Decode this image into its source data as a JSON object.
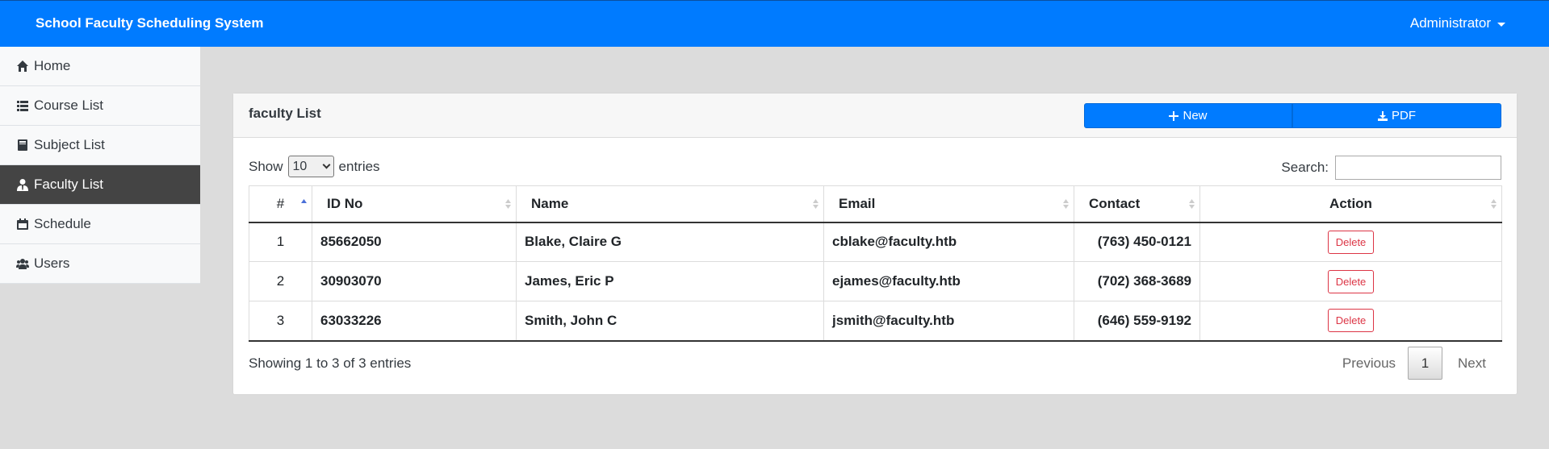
{
  "app": {
    "title": "School Faculty Scheduling System",
    "user_menu": "Administrator"
  },
  "sidebar": {
    "items": [
      {
        "label": "Home",
        "icon": "home-icon",
        "active": false
      },
      {
        "label": "Course List",
        "icon": "list-icon",
        "active": false
      },
      {
        "label": "Subject List",
        "icon": "book-icon",
        "active": false
      },
      {
        "label": "Faculty List",
        "icon": "user-tie-icon",
        "active": true
      },
      {
        "label": "Schedule",
        "icon": "calendar-icon",
        "active": false
      },
      {
        "label": "Users",
        "icon": "users-icon",
        "active": false
      }
    ]
  },
  "card": {
    "title": "faculty List",
    "new_label": "New",
    "pdf_label": "PDF"
  },
  "table_controls": {
    "show_label": "Show",
    "entries_value": "10",
    "entries_label": "entries",
    "search_label": "Search:",
    "search_value": ""
  },
  "table": {
    "headers": [
      "#",
      "ID No",
      "Name",
      "Email",
      "Contact",
      "Action"
    ],
    "rows": [
      {
        "num": "1",
        "id": "85662050",
        "name": "Blake, Claire G",
        "email": "cblake@faculty.htb",
        "contact": "(763) 450-0121",
        "action": "Delete"
      },
      {
        "num": "2",
        "id": "30903070",
        "name": "James, Eric P",
        "email": "ejames@faculty.htb",
        "contact": "(702) 368-3689",
        "action": "Delete"
      },
      {
        "num": "3",
        "id": "63033226",
        "name": "Smith, John C",
        "email": "jsmith@faculty.htb",
        "contact": "(646) 559-9192",
        "action": "Delete"
      }
    ]
  },
  "footer": {
    "info": "Showing 1 to 3 of 3 entries",
    "previous": "Previous",
    "page": "1",
    "next": "Next"
  },
  "colors": {
    "primary": "#007bff",
    "danger": "#dc3545",
    "sidebar_active": "#444444",
    "background": "#dcdcdc"
  }
}
